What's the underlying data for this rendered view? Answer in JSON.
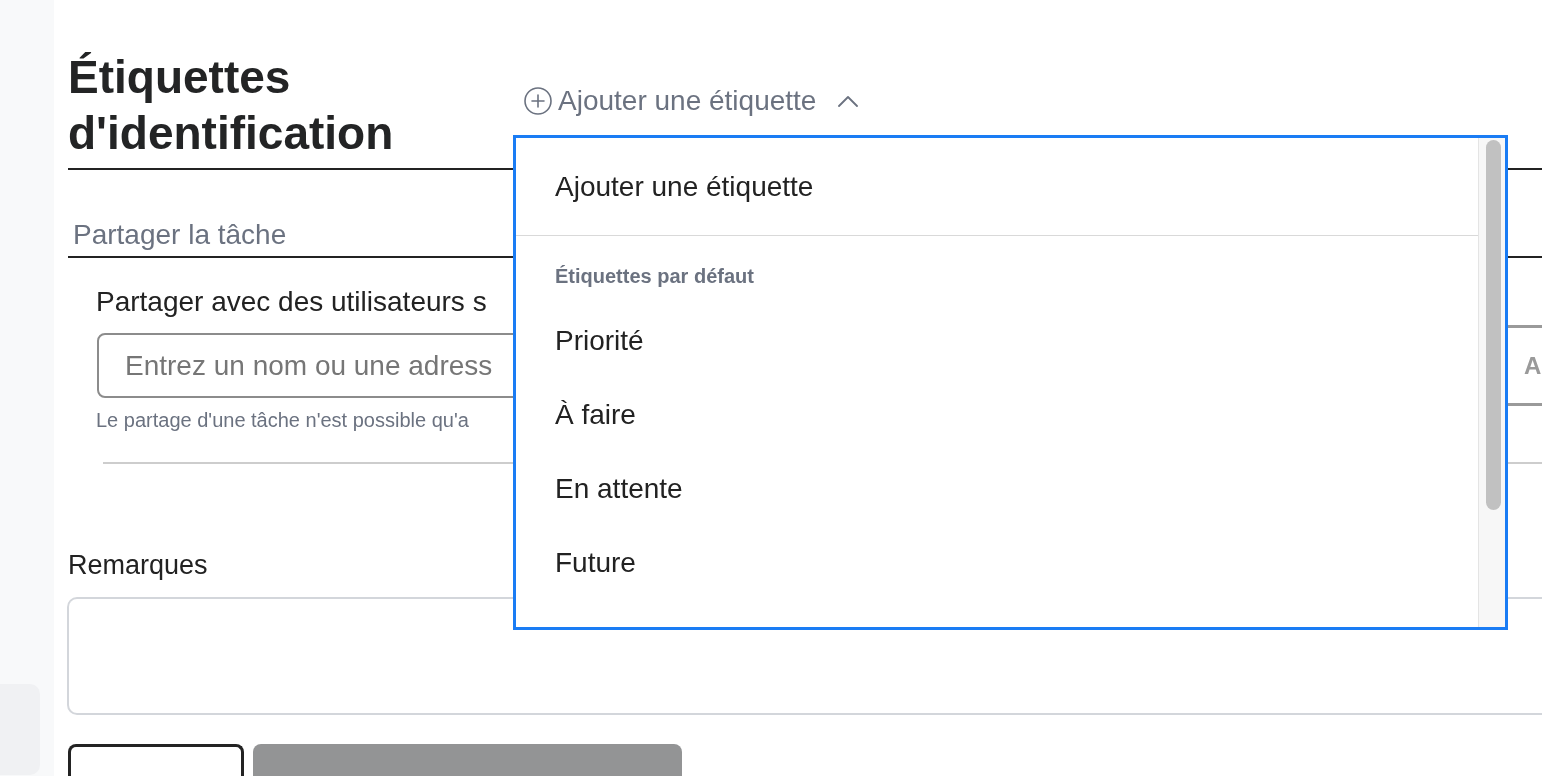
{
  "heading": {
    "title": "Étiquettes d'identification"
  },
  "tag_menu": {
    "toggle_label": "Ajouter une étiquette",
    "expanded": true,
    "add_item": "Ajouter une étiquette",
    "section_header": "Étiquettes par défaut",
    "items": [
      "Priorité",
      "À faire",
      "En attente",
      "Future"
    ]
  },
  "share": {
    "title": "Partager la tâche",
    "label": "Partager avec des utilisateurs s",
    "input": {
      "placeholder": "Entrez un nom ou une adress"
    },
    "button": {
      "label": "A",
      "disabled": true
    },
    "hint": "Le partage d'une tâche n'est possible qu'a"
  },
  "remarks": {
    "label": "Remarques"
  },
  "buttons": [
    {
      "kind": "outline"
    },
    {
      "kind": "filled",
      "disabled": true
    }
  ]
}
